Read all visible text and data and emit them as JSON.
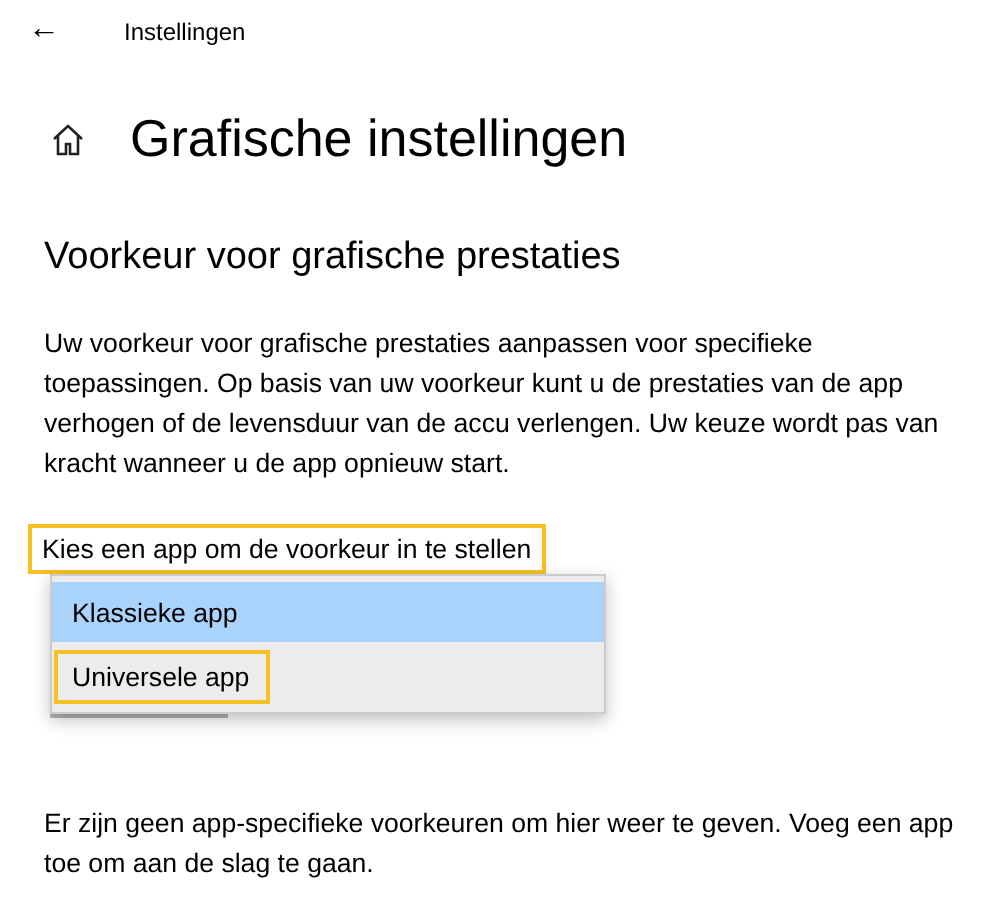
{
  "header": {
    "back": "←",
    "title": "Instellingen"
  },
  "page_title": "Grafische instellingen",
  "section_title": "Voorkeur voor grafische prestaties",
  "description": "Uw voorkeur voor grafische prestaties aanpassen voor specifieke toepassingen. Op basis van uw voorkeur kunt u de prestaties van de app verhogen of de levensduur van de accu verlengen. Uw keuze wordt pas van kracht wanneer u de app opnieuw start.",
  "picker": {
    "label": "Kies een app om de voorkeur in te stellen",
    "highlighted": true
  },
  "options": [
    {
      "label": "Klassieke app",
      "selected": true,
      "highlighted": false
    },
    {
      "label": "Universele app",
      "selected": false,
      "highlighted": true
    }
  ],
  "empty_message": "Er zijn geen app-specifieke voorkeuren om hier weer te geven. Voeg een app toe om aan de slag te gaan."
}
